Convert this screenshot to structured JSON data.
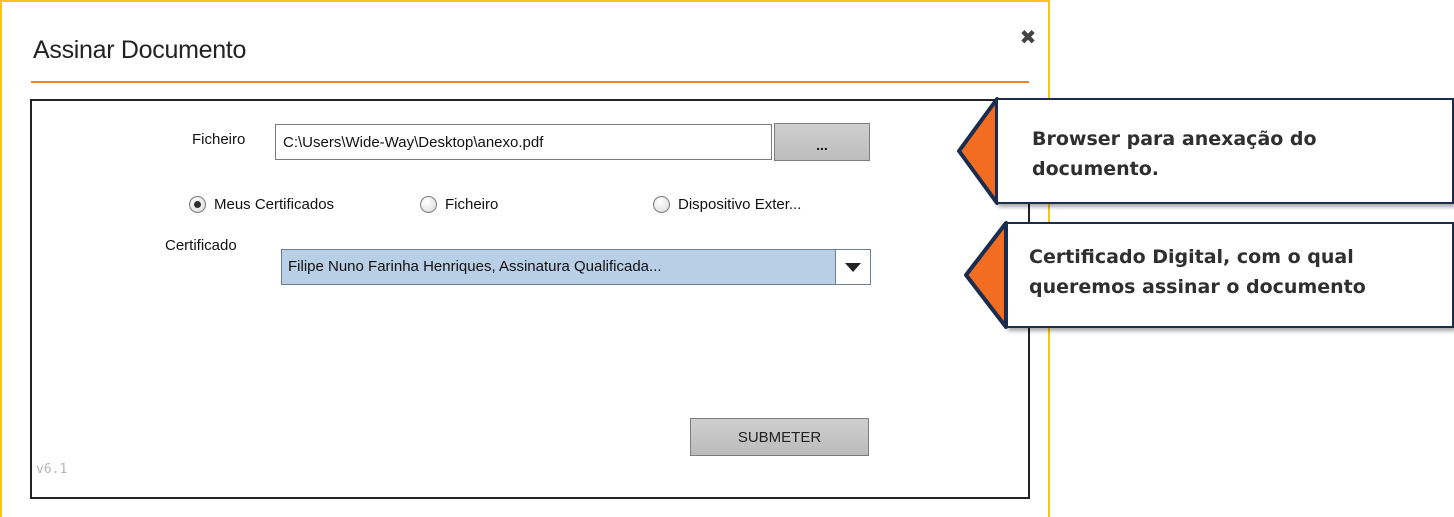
{
  "dialog": {
    "title": "Assinar Documento",
    "close_icon": "close-icon"
  },
  "form": {
    "ficheiro_label": "Ficheiro",
    "ficheiro_value": "C:\\Users\\Wide-Way\\Desktop\\anexo.pdf",
    "browse_label": "...",
    "radios": [
      {
        "label": "Meus Certificados",
        "checked": true
      },
      {
        "label": "Ficheiro",
        "checked": false
      },
      {
        "label": "Dispositivo Exter...",
        "checked": false
      }
    ],
    "certificado_label": "Certificado",
    "certificado_value": "Filipe Nuno Farinha Henriques, Assinatura Qualificada...",
    "submit_label": "SUBMETER",
    "version": "v6.1"
  },
  "callouts": [
    {
      "text_line1": "Browser para anexação do",
      "text_line2": "documento."
    },
    {
      "text_line1": "Certificado Digital, com o qual",
      "text_line2": "queremos assinar o documento"
    }
  ],
  "colors": {
    "dialog_border": "#f5c518",
    "title_rule": "#f58220",
    "callout_arrow": "#f26c21",
    "callout_border": "#1b2d4f",
    "selected_option_bg": "#b8cfe6"
  }
}
